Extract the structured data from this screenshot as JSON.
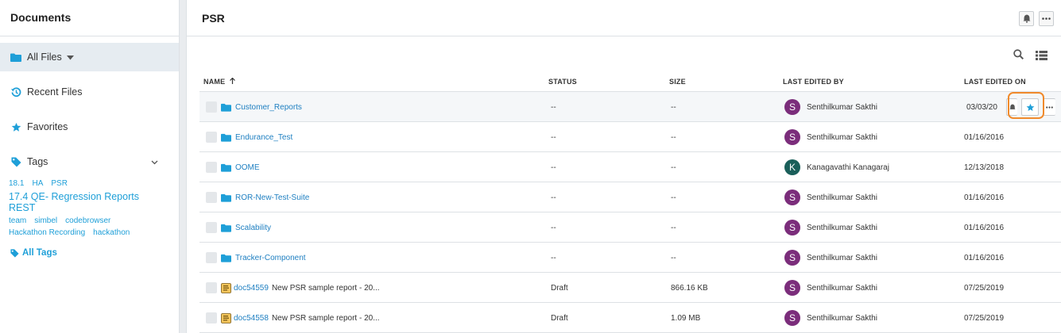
{
  "sidebar": {
    "title": "Documents",
    "items": [
      {
        "label": "All Files"
      },
      {
        "label": "Recent Files"
      },
      {
        "label": "Favorites"
      },
      {
        "label": "Tags"
      }
    ],
    "tags": {
      "line1": [
        "18.1",
        "HA",
        "PSR"
      ],
      "line2": [
        "17.4 QE- Regression Reports",
        "REST"
      ],
      "line3": [
        "team",
        "simbel",
        "codebrowser"
      ],
      "line4": [
        "Hackathon Recording",
        "hackathon"
      ]
    },
    "all_tags_label": "All Tags"
  },
  "main": {
    "title": "PSR",
    "columns": {
      "name": "NAME",
      "status": "STATUS",
      "size": "SIZE",
      "last_edited_by": "LAST EDITED BY",
      "last_edited_on": "LAST EDITED ON"
    },
    "rows": [
      {
        "name": "Customer_Reports",
        "status": "--",
        "size": "--",
        "initial": "S",
        "editor": "Senthilkumar Sakthi",
        "date": "03/03/20"
      },
      {
        "name": "Endurance_Test",
        "status": "--",
        "size": "--",
        "initial": "S",
        "editor": "Senthilkumar Sakthi",
        "date": "01/16/2016"
      },
      {
        "name": "OOME",
        "status": "--",
        "size": "--",
        "initial": "K",
        "editor": "Kanagavathi Kanagaraj",
        "date": "12/13/2018"
      },
      {
        "name": "ROR-New-Test-Suite",
        "status": "--",
        "size": "--",
        "initial": "S",
        "editor": "Senthilkumar Sakthi",
        "date": "01/16/2016"
      },
      {
        "name": "Scalability",
        "status": "--",
        "size": "--",
        "initial": "S",
        "editor": "Senthilkumar Sakthi",
        "date": "01/16/2016"
      },
      {
        "name": "Tracker-Component",
        "status": "--",
        "size": "--",
        "initial": "S",
        "editor": "Senthilkumar Sakthi",
        "date": "01/16/2016"
      },
      {
        "doc_id": "doc54559",
        "name": "New PSR sample report - 20...",
        "status": "Draft",
        "size": "866.16 KB",
        "initial": "S",
        "editor": "Senthilkumar Sakthi",
        "date": "07/25/2019"
      },
      {
        "doc_id": "doc54558",
        "name": "New PSR sample report - 20...",
        "status": "Draft",
        "size": "1.09 MB",
        "initial": "S",
        "editor": "Senthilkumar Sakthi",
        "date": "07/25/2019"
      }
    ]
  },
  "colors": {
    "accent": "#1e9fd8",
    "link": "#1e7fc1",
    "folder": "#1e9fd8",
    "avatar_s": "#7b2d7b",
    "avatar_k": "#1a5f5a",
    "highlight": "#f08a2c",
    "active_bg": "#e6ecf1"
  },
  "icons": {
    "folder": "folder-icon",
    "clock": "recent-icon",
    "star": "star-icon",
    "tag": "tag-icon",
    "search": "search-icon",
    "list": "list-view-icon",
    "bell": "bell-icon",
    "more": "more-icon",
    "doc": "document-icon"
  }
}
